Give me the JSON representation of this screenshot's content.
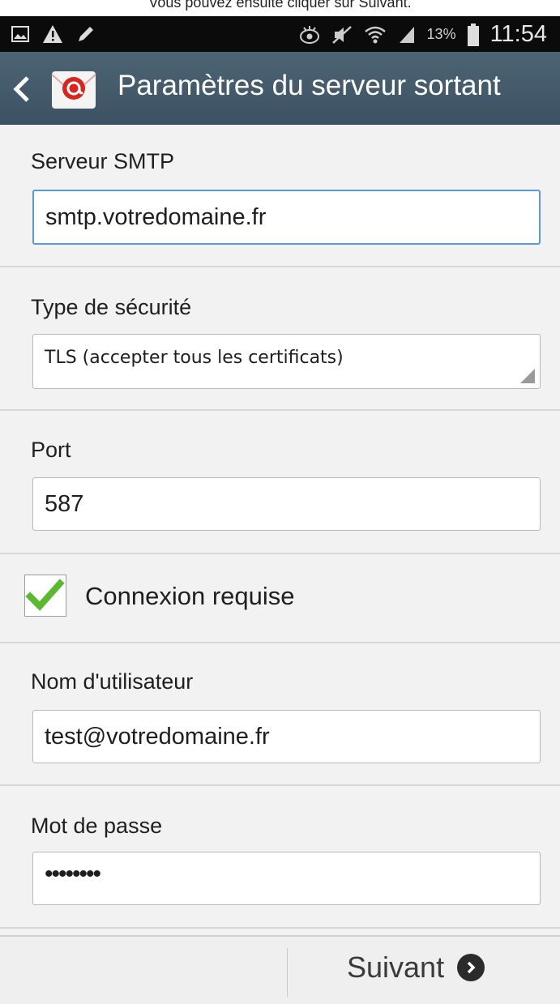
{
  "caption": "Vous pouvez ensuite cliquer sur Suivant.",
  "status_bar": {
    "time": "11:54",
    "battery": "13%",
    "icons": [
      "gallery-icon",
      "warning-icon",
      "pen-icon",
      "eye-icon",
      "mute-icon",
      "wifi-icon",
      "signal-icon",
      "battery-icon"
    ]
  },
  "action_bar": {
    "title": "Paramètres du serveur sortant",
    "back_icon": "chevron-left-icon",
    "app_icon": "email-app-icon"
  },
  "form": {
    "smtp": {
      "label": "Serveur SMTP",
      "value": "smtp.votredomaine.fr"
    },
    "security": {
      "label": "Type de sécurité",
      "value": "TLS (accepter tous les certificats)"
    },
    "port": {
      "label": "Port",
      "value": "587"
    },
    "auth": {
      "label": "Connexion requise",
      "checked": true
    },
    "username": {
      "label": "Nom d'utilisateur",
      "value": "test@votredomaine.fr"
    },
    "password": {
      "label": "Mot de passe",
      "value": "••••••••"
    }
  },
  "bottom_bar": {
    "next_label": "Suivant"
  },
  "colors": {
    "action_bar": "#455b6b",
    "focus_border": "#5b9bd5",
    "check": "#5cb82e"
  }
}
